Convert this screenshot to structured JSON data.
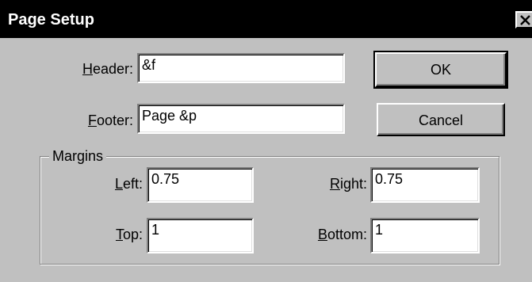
{
  "window": {
    "title": "Page Setup",
    "close_icon": "close-icon"
  },
  "header": {
    "label_key": "H",
    "label_rest": "eader:",
    "value": "&f"
  },
  "footer": {
    "label_key": "F",
    "label_rest": "ooter:",
    "value": "Page &p"
  },
  "buttons": {
    "ok_label": "OK",
    "cancel_label": "Cancel"
  },
  "margins": {
    "group_label": "Margins",
    "left": {
      "label_key": "L",
      "label_rest": "eft:",
      "value": "0.75"
    },
    "right": {
      "label_key": "R",
      "label_rest": "ight:",
      "value": "0.75"
    },
    "top": {
      "label_key": "T",
      "label_rest": "op:",
      "value": "1"
    },
    "bottom": {
      "label_key": "B",
      "label_rest": "ottom:",
      "value": "1"
    }
  },
  "colors": {
    "face": "#c0c0c0",
    "titlebar": "#000000",
    "title_text": "#ffffff"
  }
}
